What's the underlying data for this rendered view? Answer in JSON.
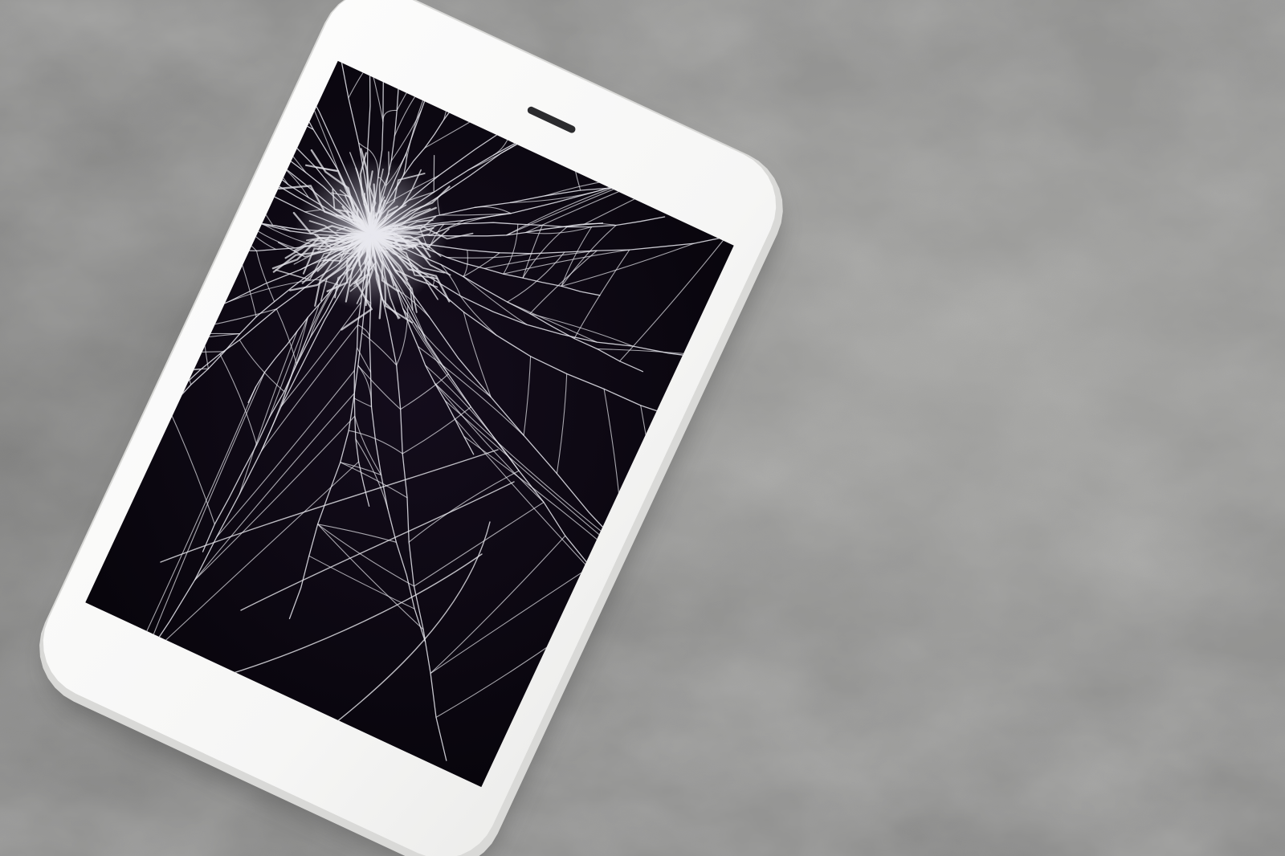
{
  "scene": {
    "subject": "smartphone-with-shattered-screen",
    "surface": "concrete",
    "colors": {
      "concrete_base": "#8d8d8c",
      "concrete_light": "#b9b9b6",
      "concrete_dark": "#6f6f6e",
      "phone_body": "#f7f7f6",
      "phone_edge": "#d9d9d7",
      "screen": "#0b0710",
      "crack": "#e8e8ee",
      "speaker": "#2b2b2e"
    }
  }
}
